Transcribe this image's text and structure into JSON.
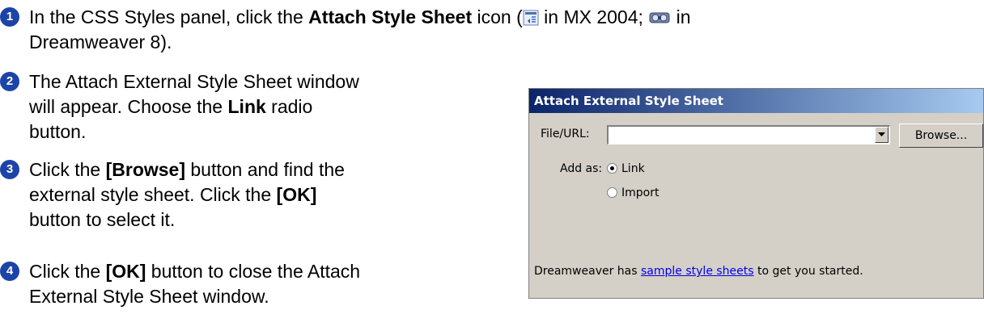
{
  "steps": [
    {
      "num": "1",
      "text_before": "In the CSS Styles panel, click the ",
      "bold": "Attach Style Sheet",
      "text_mid": " icon (",
      "icon1": "attach-stylesheet-mx2004-icon",
      "text_mid2": " in MX 2004; ",
      "icon2": "attach-stylesheet-dw8-icon",
      "text_after_l1": " in",
      "text_l2": "Dreamweaver 8)."
    },
    {
      "num": "2",
      "line1": "The Attach External Style Sheet window",
      "line2": "will appear. Choose the ",
      "bold": "Link",
      "line2_after": " radio",
      "line3": "button."
    },
    {
      "num": "3",
      "line1_before": "Click the ",
      "bold1": "[Browse]",
      "line1_after": " button and find the",
      "line2_before": "external style sheet. Click the ",
      "bold2": "[OK]",
      "line3": "button to select it."
    },
    {
      "num": "4",
      "line1_before": "Click the ",
      "bold": "[OK]",
      "line1_after": " button to close the Attach",
      "line2": "External Style Sheet window."
    }
  ],
  "dialog": {
    "title": "Attach External Style Sheet",
    "file_label": "File/URL:",
    "file_value": "",
    "browse_label": "Browse...",
    "add_as_label": "Add as:",
    "radio_link": "Link",
    "radio_import": "Import",
    "selected": "Link",
    "footer_before": "Dreamweaver has ",
    "footer_link": "sample style sheets",
    "footer_after": " to get you started."
  }
}
